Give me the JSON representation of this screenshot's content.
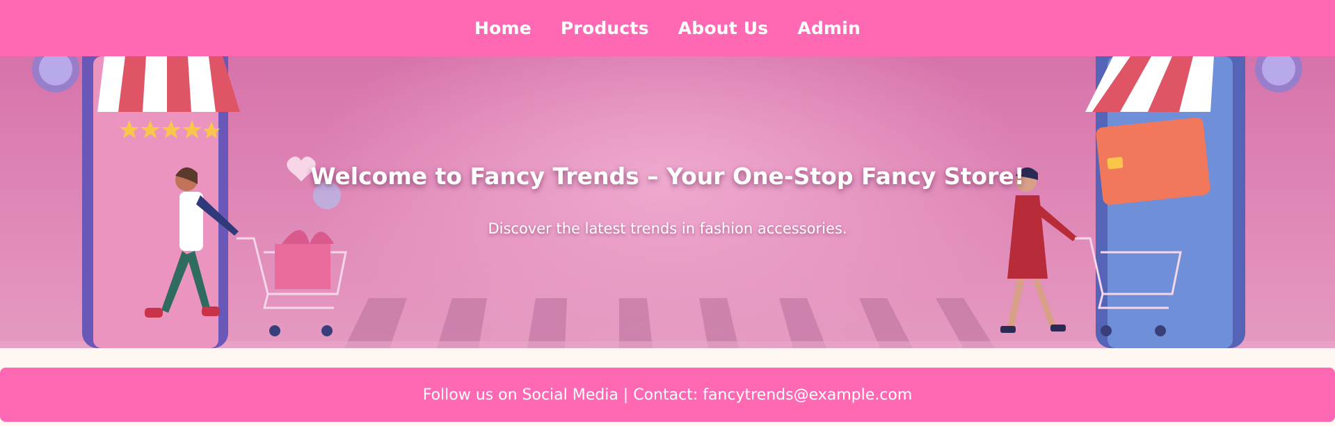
{
  "nav": {
    "items": [
      {
        "label": "Home"
      },
      {
        "label": "Products"
      },
      {
        "label": "About Us"
      },
      {
        "label": "Admin"
      }
    ]
  },
  "hero": {
    "title": "Welcome to Fancy Trends – Your One-Stop Fancy Store!",
    "subtitle": "Discover the latest trends in fashion accessories."
  },
  "footer": {
    "text": "Follow us on Social Media | Contact: fancytrends@example.com"
  },
  "colors": {
    "brand": "#ff69b4",
    "page_background": "#fff8f2",
    "text": "#ffffff"
  }
}
